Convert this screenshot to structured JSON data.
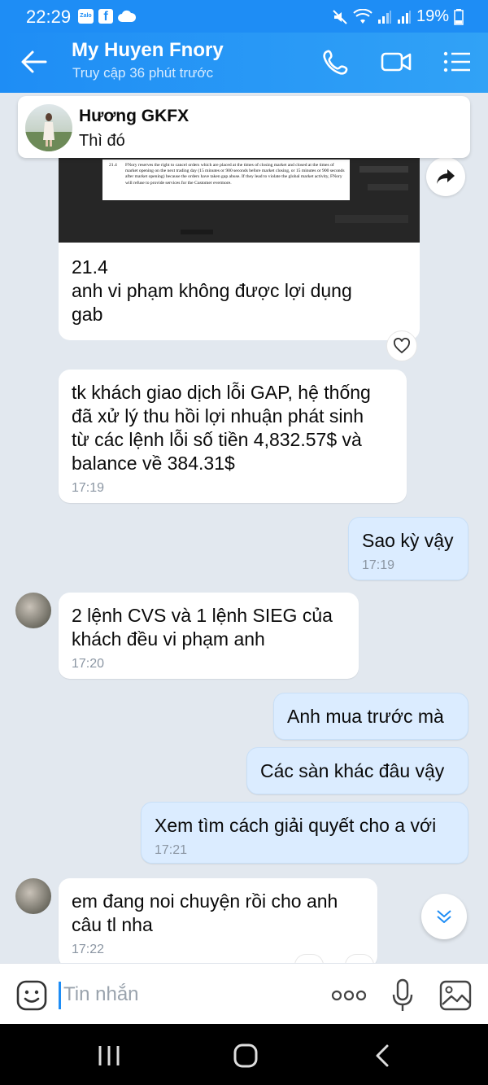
{
  "status_bar": {
    "time": "22:29",
    "battery": "19%",
    "left_icons": [
      "zalo-icon",
      "facebook-icon",
      "cloud-icon"
    ],
    "right_icons": [
      "mute-icon",
      "wifi-icon",
      "signal-icon",
      "signal-icon",
      "battery-icon"
    ]
  },
  "header": {
    "title": "My Huyen Fnory",
    "subtitle": "Truy cập 36 phút trước",
    "actions": [
      "call-icon",
      "video-icon",
      "menu-icon"
    ]
  },
  "pinned": {
    "name": "Hương GKFX",
    "message": "Thì đó"
  },
  "image_doc": {
    "clause": "21.4",
    "text": "FNory reserves the right to cancel orders which are placed at the times of closing market and closed at the times of market opening on the next trading day (15 minutes or 900 seconds before market closing, or 15 minutes or 900 seconds after market opening) because the orders have taken gap abuse. If they lead to violate the global market activity, FNory will refuse to provide services for the Customer evermore."
  },
  "messages": [
    {
      "id": "m1",
      "sender": "other",
      "lines": [
        "21.4",
        "anh vi phạm không được lợi dụng",
        "gab"
      ],
      "time": ""
    },
    {
      "id": "m2",
      "sender": "other",
      "lines": [
        "tk khách giao dịch lỗi GAP, hệ thống",
        "đã xử lý thu hồi lợi nhuận phát sinh",
        "từ các lệnh lỗi số tiền  4,832.57$ và",
        "balance về 384.31$"
      ],
      "time": "17:19"
    },
    {
      "id": "m3",
      "sender": "me",
      "lines": [
        "Sao kỳ vậy"
      ],
      "time": "17:19"
    },
    {
      "id": "m4",
      "sender": "other",
      "lines": [
        "2 lệnh CVS và 1 lệnh SIEG của",
        "khách đều vi phạm anh"
      ],
      "time": "17:20"
    },
    {
      "id": "m5",
      "sender": "me",
      "lines": [
        "Anh mua trước mà"
      ],
      "time": ""
    },
    {
      "id": "m6",
      "sender": "me",
      "lines": [
        "Các sàn khác đâu vậy"
      ],
      "time": ""
    },
    {
      "id": "m7",
      "sender": "me",
      "lines": [
        "Xem tìm cách giải quyết cho a với"
      ],
      "time": "17:21"
    },
    {
      "id": "m8",
      "sender": "other",
      "lines": [
        "em đang noi chuyện rồi cho anh",
        "câu tl nha"
      ],
      "time": "17:22"
    }
  ],
  "composer": {
    "placeholder": "Tin nhắn"
  },
  "colors": {
    "brand": "#1e8df5",
    "my_bubble": "#dbecff",
    "their_bubble": "#ffffff",
    "chat_bg": "#e2e8ef"
  }
}
